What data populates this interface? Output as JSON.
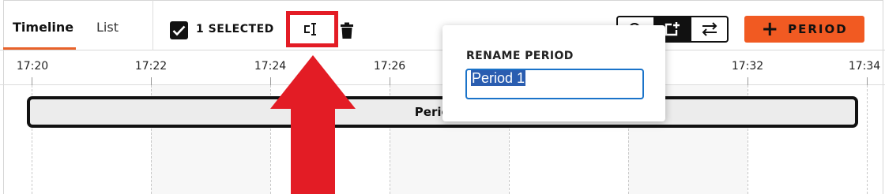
{
  "tabs": [
    {
      "label": "Timeline",
      "active": true
    },
    {
      "label": "List",
      "active": false
    }
  ],
  "selection": {
    "label": "1 SELECTED",
    "checked": true
  },
  "toolbar": {
    "rename_icon": "rename-icon",
    "delete_icon": "trash-icon",
    "view_buttons": [
      "zoom-icon",
      "add-frame-icon",
      "swap-icon"
    ],
    "add_period_label": "PERIOD"
  },
  "axis": {
    "ticks": [
      "17:20",
      "17:22",
      "17:24",
      "17:26",
      "17:32",
      "17:34"
    ]
  },
  "period": {
    "label": "Period 1"
  },
  "rename_popup": {
    "title": "RENAME PERIOD",
    "value": "Period 1"
  },
  "colors": {
    "accent": "#f15a22",
    "highlight": "#e31c25",
    "focus": "#1a73c9"
  }
}
